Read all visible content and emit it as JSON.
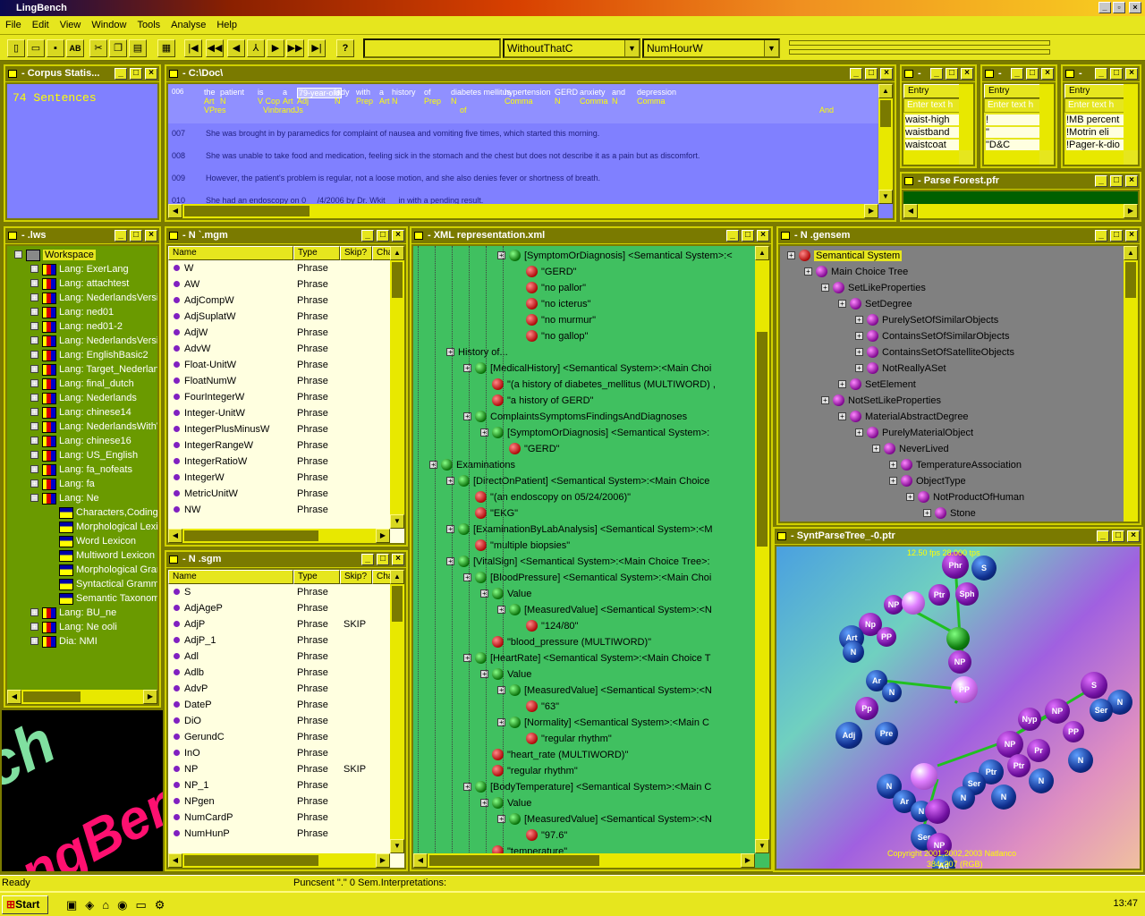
{
  "app": {
    "title": "LingBench"
  },
  "menu": [
    "File",
    "Edit",
    "View",
    "Window",
    "Tools",
    "Analyse",
    "Help"
  ],
  "toolbar": {
    "combo1": "WithoutThatC",
    "combo2": "NumHourW",
    "btn_ab": "AB",
    "btn_help": "?"
  },
  "corpus_stats": {
    "title": "- Corpus Statis...",
    "sentences": "74  Sentences"
  },
  "doc_window": {
    "title": "- C:\\Doc\\",
    "row_num": "006",
    "tokens": [
      "the",
      "patient",
      "is",
      "a",
      "79-year-old",
      "lady",
      "with",
      "a",
      "history",
      "of",
      "diabetes mellitus",
      "hypertension",
      "GERD",
      "anxiety",
      "and",
      "depression"
    ],
    "tags": [
      "Art",
      "N",
      "V Cop",
      "Art",
      "Adj",
      "N",
      "Prep",
      "Art",
      "N",
      "Prep",
      "N",
      "Comma",
      "N",
      "Comma",
      "N",
      "Comma",
      "Conj"
    ],
    "tags2": [
      "VPres",
      "of",
      "And"
    ],
    "tag3": "VinbrandJs",
    "sentences": [
      {
        "num": "007",
        "text": "She was brought in by paramedics for complaint of nausea and vomiting five times, which started this morning."
      },
      {
        "num": "008",
        "text": "She was unable to take food and medication, feeling sick in the stomach and the chest but does not describe it as a pain but as discomfort."
      },
      {
        "num": "009",
        "text": "However, the patient's problem is regular, not a loose motion, and she also denies fever or shortness of breath."
      },
      {
        "num": "010",
        "text": "She had an endoscopy on 0__ /4/2006 by Dr. Wkit_ _ in with a pending result."
      }
    ]
  },
  "small_wins": [
    {
      "title": "- ",
      "col": "Entry",
      "placeholder": "Enter text h",
      "items": [
        "waist-high",
        "waistband",
        "waistcoat"
      ]
    },
    {
      "title": "- ",
      "col": "Entry",
      "placeholder": "Enter text h",
      "items": [
        "!",
        "\"",
        "\"D&C"
      ]
    },
    {
      "title": "- ",
      "col": "Entry",
      "placeholder": "Enter text h",
      "items": [
        "!MB percent",
        "!Motrin eli",
        "!Pager-k-dio"
      ]
    }
  ],
  "parse_forest": {
    "title": "- Parse Forest.pfr"
  },
  "workspace": {
    "title": "- .lws",
    "root": "Workspace",
    "items": [
      "Lang: ExerLang",
      "Lang: attachtest",
      "Lang: NederlandsVersie",
      "Lang: ned01",
      "Lang: ned01-2",
      "Lang: NederlandsVersie",
      "Lang: EnglishBasic2",
      "Lang: Target_Nederlands",
      "Lang: final_dutch",
      "Lang: Nederlands",
      "Lang: chinese14",
      "Lang: NederlandsWithV",
      "Lang: chinese16",
      "Lang: US_English",
      "Lang: fa_nofeats",
      "Lang: fa",
      "Lang: Ne"
    ],
    "subitems": [
      "Characters,Coding",
      "Morphological Lexicon",
      "Word Lexicon",
      "Multiword Lexicon",
      "Morphological Grammar",
      "Syntactical Grammar",
      "Semantic Taxonomy"
    ],
    "tail": [
      "Lang: BU_ne",
      "Lang: Ne            ooli",
      "Dia: NMI"
    ]
  },
  "mgm": {
    "title": "- N          `.mgm",
    "cols": [
      "Name",
      "Type",
      "Skip?",
      "Cha"
    ],
    "rows": [
      [
        "W",
        "Phrase",
        ""
      ],
      [
        "AW",
        "Phrase",
        ""
      ],
      [
        "AdjCompW",
        "Phrase",
        ""
      ],
      [
        "AdjSuplatW",
        "Phrase",
        ""
      ],
      [
        "AdjW",
        "Phrase",
        ""
      ],
      [
        "AdvW",
        "Phrase",
        ""
      ],
      [
        "Float-UnitW",
        "Phrase",
        ""
      ],
      [
        "FloatNumW",
        "Phrase",
        ""
      ],
      [
        "FourIntegerW",
        "Phrase",
        ""
      ],
      [
        "Integer-UnitW",
        "Phrase",
        ""
      ],
      [
        "IntegerPlusMinusW",
        "Phrase",
        ""
      ],
      [
        "IntegerRangeW",
        "Phrase",
        ""
      ],
      [
        "IntegerRatioW",
        "Phrase",
        ""
      ],
      [
        "IntegerW",
        "Phrase",
        ""
      ],
      [
        "MetricUnitW",
        "Phrase",
        ""
      ],
      [
        "NW",
        "Phrase",
        ""
      ]
    ]
  },
  "sgm": {
    "title": "- N          .sgm",
    "cols": [
      "Name",
      "Type",
      "Skip?",
      "Cha"
    ],
    "rows": [
      [
        "S",
        "Phrase",
        ""
      ],
      [
        "AdjAgeP",
        "Phrase",
        ""
      ],
      [
        "AdjP",
        "Phrase",
        "SKIP"
      ],
      [
        "AdjP_1",
        "Phrase",
        ""
      ],
      [
        "Adl",
        "Phrase",
        ""
      ],
      [
        "Adlb",
        "Phrase",
        ""
      ],
      [
        "AdvP",
        "Phrase",
        ""
      ],
      [
        "DateP",
        "Phrase",
        ""
      ],
      [
        "DiO",
        "Phrase",
        ""
      ],
      [
        "GerundC",
        "Phrase",
        ""
      ],
      [
        "InO",
        "Phrase",
        ""
      ],
      [
        "NP",
        "Phrase",
        "SKIP"
      ],
      [
        "NP_1",
        "Phrase",
        ""
      ],
      [
        "NPgen",
        "Phrase",
        ""
      ],
      [
        "NumCardP",
        "Phrase",
        ""
      ],
      [
        "NumHunP",
        "Phrase",
        ""
      ]
    ]
  },
  "xml": {
    "title": "- XML representation.xml",
    "nodes": [
      {
        "d": 6,
        "c": "g",
        "e": 1,
        "t": "[SymptomOrDiagnosis]   <Semantical System>:<"
      },
      {
        "d": 7,
        "c": "r",
        "e": 0,
        "t": "\"GERD\""
      },
      {
        "d": 7,
        "c": "r",
        "e": 0,
        "t": "\"no pallor\""
      },
      {
        "d": 7,
        "c": "r",
        "e": 0,
        "t": "\"no icterus\""
      },
      {
        "d": 7,
        "c": "r",
        "e": 0,
        "t": "\"no murmur\""
      },
      {
        "d": 7,
        "c": "r",
        "e": 0,
        "t": "\"no gallop\""
      },
      {
        "d": 3,
        "c": "n",
        "e": 1,
        "t": "History of..."
      },
      {
        "d": 4,
        "c": "g",
        "e": 1,
        "t": "[MedicalHistory]   <Semantical System>:<Main Choi"
      },
      {
        "d": 5,
        "c": "r",
        "e": 0,
        "t": "\"(a history of diabetes_mellitus (MULTIWORD) ,"
      },
      {
        "d": 5,
        "c": "r",
        "e": 0,
        "t": "\"a history of GERD\""
      },
      {
        "d": 4,
        "c": "g",
        "e": 1,
        "t": "ComplaintsSymptomsFindingsAndDiagnoses"
      },
      {
        "d": 5,
        "c": "g",
        "e": 1,
        "t": "[SymptomOrDiagnosis]   <Semantical System>:"
      },
      {
        "d": 6,
        "c": "r",
        "e": 0,
        "t": "\"GERD\""
      },
      {
        "d": 2,
        "c": "g",
        "e": 1,
        "t": "Examinations"
      },
      {
        "d": 3,
        "c": "g",
        "e": 1,
        "t": "[DirectOnPatient]   <Semantical System>:<Main Choice"
      },
      {
        "d": 4,
        "c": "r",
        "e": 0,
        "t": "\"(an endoscopy on 05/24/2006)\""
      },
      {
        "d": 4,
        "c": "r",
        "e": 0,
        "t": "\"EKG\""
      },
      {
        "d": 3,
        "c": "g",
        "e": 1,
        "t": "[ExaminationByLabAnalysis]   <Semantical System>:<M"
      },
      {
        "d": 4,
        "c": "r",
        "e": 0,
        "t": "\"multiple biopsies\""
      },
      {
        "d": 3,
        "c": "g",
        "e": 1,
        "t": "[VitalSign]   <Semantical System>:<Main Choice Tree>:"
      },
      {
        "d": 4,
        "c": "g",
        "e": 1,
        "t": "[BloodPressure]   <Semantical System>:<Main Choi"
      },
      {
        "d": 5,
        "c": "g",
        "e": 1,
        "t": "Value"
      },
      {
        "d": 6,
        "c": "g",
        "e": 1,
        "t": "[MeasuredValue]   <Semantical System>:<N"
      },
      {
        "d": 7,
        "c": "r",
        "e": 0,
        "t": "\"124/80\""
      },
      {
        "d": 5,
        "c": "r",
        "e": 0,
        "t": "\"blood_pressure (MULTIWORD)\""
      },
      {
        "d": 4,
        "c": "g",
        "e": 1,
        "t": "[HeartRate]   <Semantical System>:<Main Choice T"
      },
      {
        "d": 5,
        "c": "g",
        "e": 1,
        "t": "Value"
      },
      {
        "d": 6,
        "c": "g",
        "e": 1,
        "t": "[MeasuredValue]   <Semantical System>:<N"
      },
      {
        "d": 7,
        "c": "r",
        "e": 0,
        "t": "\"63\""
      },
      {
        "d": 6,
        "c": "g",
        "e": 1,
        "t": "[Normality]   <Semantical System>:<Main C"
      },
      {
        "d": 7,
        "c": "r",
        "e": 0,
        "t": "\"regular rhythm\""
      },
      {
        "d": 5,
        "c": "r",
        "e": 0,
        "t": "\"heart_rate (MULTIWORD)\""
      },
      {
        "d": 5,
        "c": "r",
        "e": 0,
        "t": "\"regular rhythm\""
      },
      {
        "d": 4,
        "c": "g",
        "e": 1,
        "t": "[BodyTemperature]   <Semantical System>:<Main C"
      },
      {
        "d": 5,
        "c": "g",
        "e": 1,
        "t": "Value"
      },
      {
        "d": 6,
        "c": "g",
        "e": 1,
        "t": "[MeasuredValue]   <Semantical System>:<N"
      },
      {
        "d": 7,
        "c": "r",
        "e": 0,
        "t": "\"97.6\""
      },
      {
        "d": 5,
        "c": "r",
        "e": 0,
        "t": "\"temperature\""
      }
    ]
  },
  "gensem": {
    "title": "- N          .gensem",
    "nodes": [
      {
        "d": 0,
        "c": "r",
        "t": "Semantical System"
      },
      {
        "d": 1,
        "c": "p",
        "t": "Main Choice Tree"
      },
      {
        "d": 2,
        "c": "p",
        "t": "SetLikeProperties"
      },
      {
        "d": 3,
        "c": "p",
        "t": "SetDegree"
      },
      {
        "d": 4,
        "c": "p",
        "t": "PurelySetOfSimilarObjects"
      },
      {
        "d": 4,
        "c": "p",
        "t": "ContainsSetOfSimilarObjects"
      },
      {
        "d": 4,
        "c": "p",
        "t": "ContainsSetOfSatelliteObjects"
      },
      {
        "d": 4,
        "c": "p",
        "t": "NotReallyASet"
      },
      {
        "d": 3,
        "c": "p",
        "t": "SetElement"
      },
      {
        "d": 2,
        "c": "p",
        "t": "NotSetLikeProperties"
      },
      {
        "d": 3,
        "c": "p",
        "t": "MaterialAbstractDegree"
      },
      {
        "d": 4,
        "c": "p",
        "t": "PurelyMaterialObject"
      },
      {
        "d": 5,
        "c": "p",
        "t": "NeverLived"
      },
      {
        "d": 6,
        "c": "p",
        "t": "TemperatureAssociation"
      },
      {
        "d": 6,
        "c": "p",
        "t": "ObjectType"
      },
      {
        "d": 7,
        "c": "p",
        "t": "NotProductOfHuman"
      },
      {
        "d": 8,
        "c": "p",
        "t": "Stone"
      }
    ]
  },
  "synt": {
    "title": "- SyntParseTree_-0.ptr",
    "fps": "12.50 fps  28.000 tps",
    "copyright": "Copyright 2001,2002,2003 Natlanco",
    "size": "384x307 (RGB)"
  },
  "splash": {
    "text": "ngBench",
    "text2": "nch"
  },
  "status": {
    "ready": "Ready",
    "info": "Puncsent \".\"  0 Sem.Interpretations:"
  },
  "taskbar": {
    "start": "Start",
    "clock": "13:47"
  }
}
